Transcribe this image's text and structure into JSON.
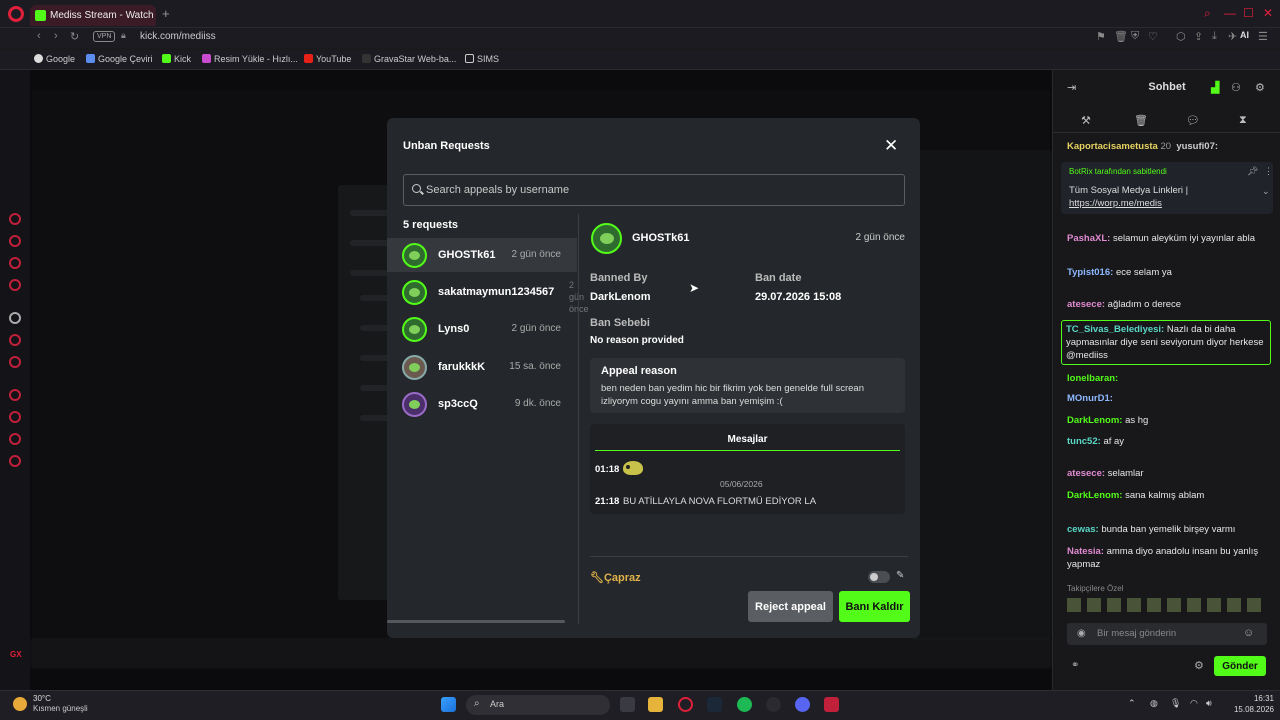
{
  "browser": {
    "tab_title": "Mediss Stream - Watch",
    "new_tab": "+",
    "vpn": "VPN",
    "url": "kick.com/mediiss",
    "ai_label": "AI",
    "bookmarks": [
      "Google",
      "Google Çeviri",
      "Kick",
      "Resim Yükle - Hızlı...",
      "YouTube",
      "GravaStar Web-ba...",
      "SIMS"
    ]
  },
  "modal": {
    "title": "Unban Requests",
    "close": "✕",
    "search_placeholder": "Search appeals by username",
    "request_count": "5 requests",
    "requests": [
      {
        "name": "GHOSTk61",
        "time": "2 gün önce"
      },
      {
        "name": "sakatmaymun1234567",
        "time": "2 gün önce"
      },
      {
        "name": "Lyns0",
        "time": "2 gün önce"
      },
      {
        "name": "farukkkK",
        "time": "15 sa. önce"
      },
      {
        "name": "sp3ccQ",
        "time": "9 dk. önce"
      }
    ],
    "detail": {
      "name": "GHOSTk61",
      "time": "2 gün önce",
      "banned_by_label": "Banned By",
      "banned_by": "DarkLenom",
      "ban_date_label": "Ban date",
      "ban_date": "29.07.2026 15:08",
      "ban_reason_label": "Ban Sebebi",
      "ban_reason": "No reason provided",
      "appeal_label": "Appeal reason",
      "appeal_text": "ben neden ban yedim hic bir fikrim yok ben genelde full screan izliyorym cogu yayını amma ban yemişim :(",
      "messages_tab": "Mesajlar",
      "msg1_time": "01:18",
      "msg_date": "05/06/2026",
      "msg2_time": "21:18",
      "msg2_text": "BU ATİLLAYLA NOVA FLORTMÜ EDİYOR LA",
      "capraz": "Çapraz",
      "reject": "Reject appeal",
      "unban": "Banı Kaldır"
    }
  },
  "chat": {
    "title": "Sohbet",
    "pinned_by": "BotRix tarafından sabitlendi",
    "pinned_text": "Tüm Sosyal Medya Linkleri |",
    "pinned_link": "https://worp.me/medis",
    "top_users": [
      "Kaportacisametusta",
      "yusufi07:"
    ],
    "messages": [
      {
        "user": "PashaXL:",
        "text": "selamun aleyküm iyi yayınlar abla"
      },
      {
        "user": "Typist016:",
        "text": "ece selam ya"
      },
      {
        "user": "atesece:",
        "text": "ağladım o derece"
      },
      {
        "user": "TC_Sivas_Belediyesi:",
        "text": "Nazlı da bi daha yapmasınlar diye seni seviyorum diyor herkese @mediiss"
      },
      {
        "user": "lonelbaran:",
        "text": ""
      },
      {
        "user": "MOnurD1:",
        "text": ""
      },
      {
        "user": "DarkLenom:",
        "text": "as hg"
      },
      {
        "user": "tunc52:",
        "text": "af ay"
      },
      {
        "user": "atesece:",
        "text": "selamlar"
      },
      {
        "user": "DarkLenom:",
        "text": "sana kalmış ablam"
      },
      {
        "user": "cewas:",
        "text": "bunda ban yemelik birşey varmı"
      },
      {
        "user": "Natesia:",
        "text": "amma diyo anadolu insanı bu yanlış yapmaz"
      }
    ],
    "supporters": "Takipçilere Özel",
    "input_placeholder": "Bir mesaj gönderin",
    "send": "Gönder"
  },
  "taskbar": {
    "weather_temp": "30°C",
    "weather_desc": "Kısmen güneşli",
    "search": "Ara",
    "time": "16:31",
    "date": "15.08.2026"
  },
  "colors": {
    "accent": "#53fc18",
    "opera_red": "#e0203a",
    "modal_bg": "#24272b"
  }
}
